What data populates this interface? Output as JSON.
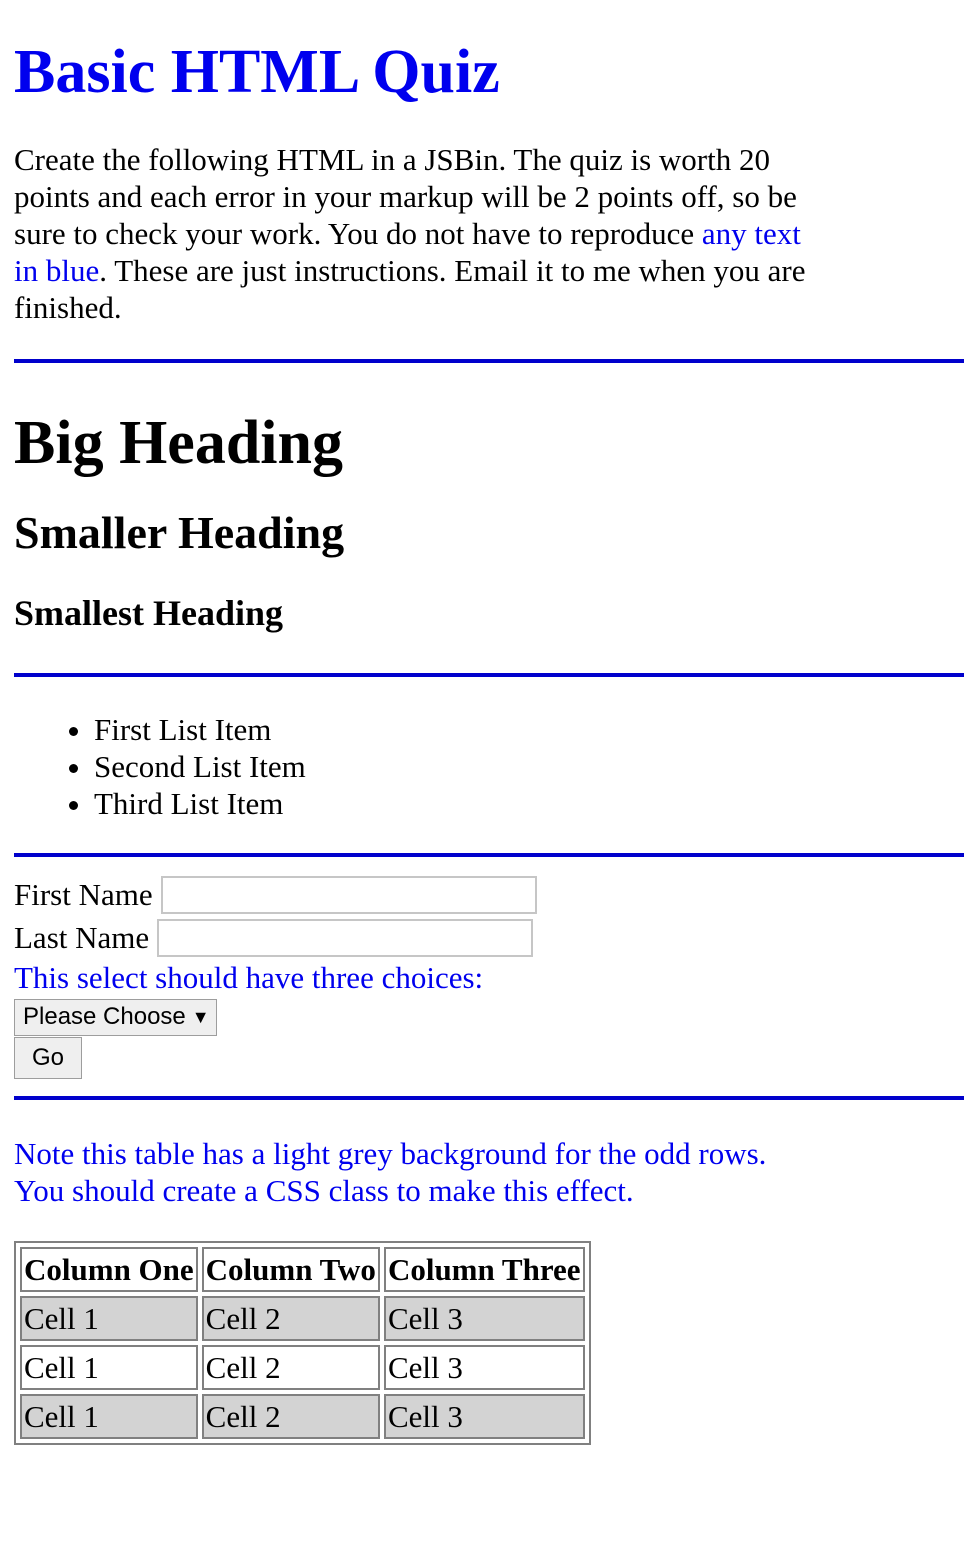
{
  "title": "Basic HTML Quiz",
  "intro": {
    "before": "Create the following HTML in a JSBin. The quiz is worth 20 points and each error in your markup will be 2 points off, so be sure to check your work. You do not have to reproduce ",
    "highlight": "any text in blue",
    "after": ". These are just instructions. Email it to me when you are finished."
  },
  "headings": {
    "big": "Big Heading",
    "smaller": "Smaller Heading",
    "smallest": "Smallest Heading"
  },
  "list": [
    "First List Item",
    "Second List Item",
    "Third List Item"
  ],
  "form": {
    "first_name_label": "First Name",
    "first_name_value": "",
    "last_name_label": "Last Name",
    "last_name_value": "",
    "select_note": "This select should have three choices:",
    "select_value": "Please Choose",
    "go_label": "Go"
  },
  "table": {
    "note_line1": "Note this table has a light grey background for the odd rows.",
    "note_line2": "You should create a CSS class to make this effect.",
    "headers": [
      "Column One",
      "Column Two",
      "Column Three"
    ],
    "rows": [
      [
        "Cell 1",
        "Cell 2",
        "Cell 3"
      ],
      [
        "Cell 1",
        "Cell 2",
        "Cell 3"
      ],
      [
        "Cell 1",
        "Cell 2",
        "Cell 3"
      ]
    ]
  },
  "colors": {
    "instruction_text": "#0000ee",
    "rule": "#0000cc",
    "odd_row_bg": "#d3d3d3"
  },
  "icons": {
    "select_caret": "chevron-down-icon"
  }
}
